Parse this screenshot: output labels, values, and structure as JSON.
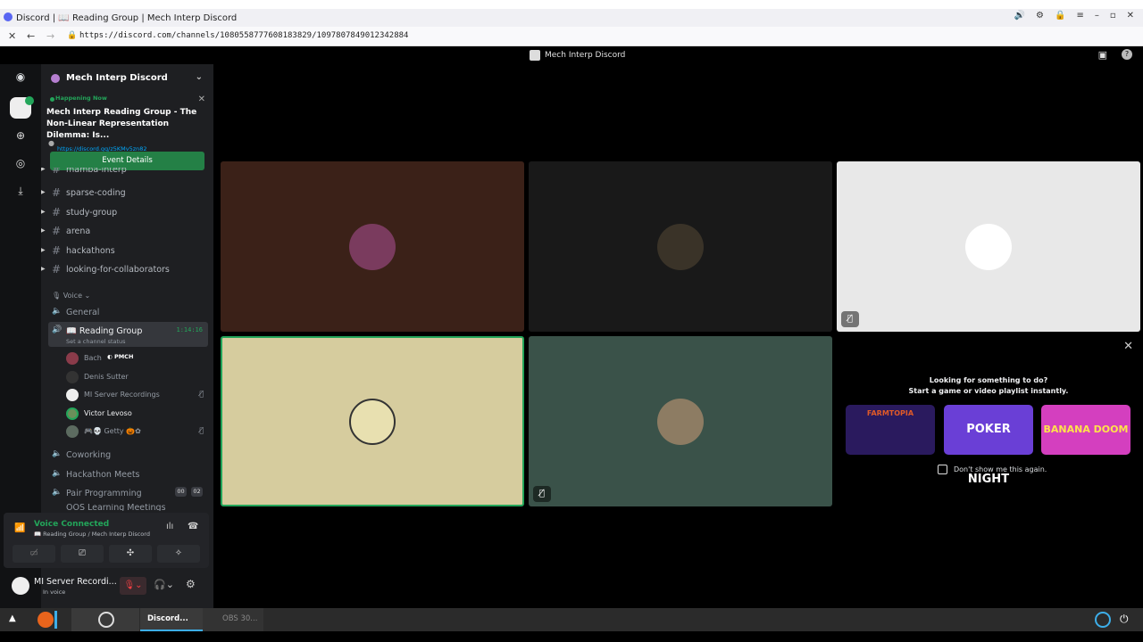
{
  "browser": {
    "tab_title": "Discord | 📖 Reading Group | Mech Interp Discord",
    "url": "https://discord.com/channels/1080558777608183829/1097807849012342884"
  },
  "topbar": {
    "server_title": "Mech Interp Discord"
  },
  "server": {
    "name": "Mech Interp Discord"
  },
  "event": {
    "status": "Happening Now",
    "title": "Mech Interp Reading Group - The Non-Linear Representation Dilemma: Is...",
    "link": "https://discord.gg/z5KMv5zn82",
    "button": "Event Details"
  },
  "channels": [
    {
      "name": "mamba-interp"
    },
    {
      "name": "sparse-coding"
    },
    {
      "name": "study-group"
    },
    {
      "name": "arena"
    },
    {
      "name": "hackathons"
    },
    {
      "name": "looking-for-collaborators"
    }
  ],
  "voice_category": "Voice",
  "voice_channels": {
    "general": "General",
    "reading_group": "📖 Reading Group",
    "reading_group_time": "1:14:16",
    "reading_group_status": "Set a channel status",
    "coworking": "Coworking",
    "hackathon": "Hackathon Meets",
    "pair": "Pair Programming",
    "pair_count_a": "00",
    "pair_count_b": "02",
    "partial": "OOS Learning Meetings"
  },
  "members": [
    {
      "name": "Bach",
      "badge": "PMCH"
    },
    {
      "name": "Denis Sutter"
    },
    {
      "name": "MI Server Recordings"
    },
    {
      "name": "Victor Levoso"
    },
    {
      "name": "🎮💀 Getty 🎃✿"
    }
  ],
  "voice_panel": {
    "title": "Voice Connected",
    "subtitle": "📖 Reading Group / Mech Interp Discord"
  },
  "user": {
    "name": "MI Server Recordi...",
    "status": "In voice"
  },
  "activity": {
    "line1": "Looking for something to do?",
    "line2": "Start a game or video playlist instantly.",
    "games": [
      "FARMTOPIA",
      "POKER NIGHT",
      "BANANA DOOM"
    ],
    "checkbox_label": "Don't show me this again."
  },
  "taskbar": {
    "discord": "Discord...",
    "obs": "OBS 30..."
  },
  "colors": {
    "tile1": "#3b2118",
    "tile2": "#191919",
    "tile3": "#e8e8e8",
    "tile4": "#d6cc9e",
    "tile5": "#3a5249",
    "accent_green": "#23a55a"
  }
}
